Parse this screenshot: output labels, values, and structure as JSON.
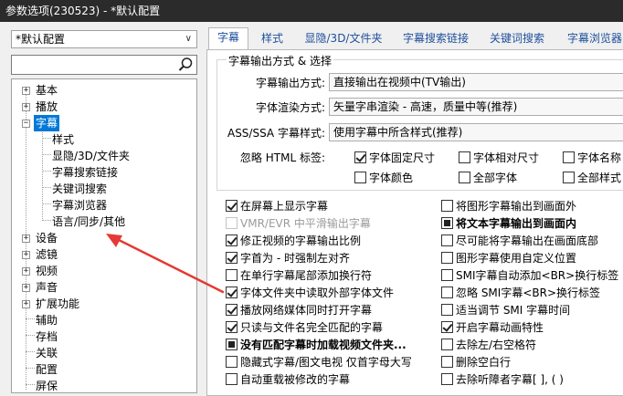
{
  "window": {
    "title": "参数选项(230523) - *默认配置"
  },
  "profile": {
    "selected": "*默认配置"
  },
  "search": {
    "value": "",
    "placeholder": ""
  },
  "tree": {
    "basic": "基本",
    "playback": "播放",
    "subtitle": "字幕",
    "style": "样式",
    "show_hide": "显隐/3D/文件夹",
    "search_link": "字幕搜索链接",
    "keyword": "关键词搜索",
    "browser": "字幕浏览器",
    "lang": "语言/同步/其他",
    "device": "设备",
    "filter": "滤镜",
    "video": "视频",
    "audio": "声音",
    "extensions": "扩展功能",
    "assist": "辅助",
    "storage": "存档",
    "assoc": "关联",
    "config": "配置",
    "screensaver": "屏保"
  },
  "tabs": [
    "字幕",
    "样式",
    "显隐/3D/文件夹",
    "字幕搜索链接",
    "关键词搜索",
    "字幕浏览器"
  ],
  "output_group": {
    "title": "字幕输出方式 & 选择",
    "output_label": "字幕输出方式:",
    "output_value": "直接输出在视频中(TV输出)",
    "render_label": "字体渲染方式:",
    "render_value": "矢量字串渲染 - 高速，质量中等(推荐)",
    "ass_label": "ASS/SSA 字幕样式:",
    "ass_value": "使用字幕中所含样式(推荐)",
    "ignore_label": "忽略 HTML 标签:",
    "ignore_opts": [
      "字体固定尺寸",
      "字体相对尺寸",
      "字体名称",
      "字体颜色",
      "全部字体",
      "全部样式"
    ]
  },
  "left_options": [
    "在屏幕上显示字幕",
    "VMR/EVR 中平滑输出字幕",
    "修正视频的字幕输出比例",
    "字首为 - 时强制左对齐",
    "在单行字幕尾部添加换行符",
    "字体文件夹中读取外部字体文件",
    "播放网络媒体同时打开字幕",
    "只读与文件名完全匹配的字幕",
    "没有匹配字幕时加载视频文件夹...",
    "隐藏式字幕/图文电视 仅首字母大写",
    "自动重载被修改的字幕"
  ],
  "right_options": [
    "将图形字幕输出到画面外",
    "将文本字幕输出到画面内",
    "尽可能将字幕输出在画面底部",
    "图形字幕使用自定义位置",
    "SMI字幕自动添加<BR>换行标签",
    "忽略 SMI字幕<BR>换行标签",
    "适当调节 SMI 字幕时间",
    "开启字幕动画特性",
    "去除左/右空格符",
    "删除空白行",
    "去除听障者字幕[ ], ( )"
  ],
  "colors": {
    "accent": "#0078d7",
    "arrow": "#e53935",
    "tab_text": "#1e4f9c"
  }
}
